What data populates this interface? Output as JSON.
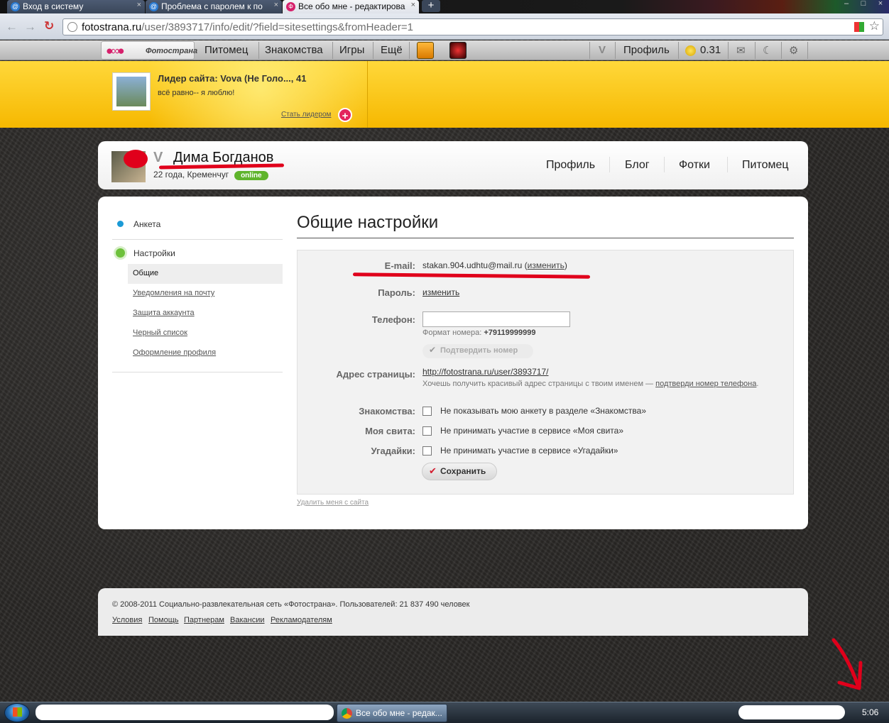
{
  "browser": {
    "tabs": [
      {
        "title": "Вход в систему",
        "favicon": "mail-icon",
        "active": false
      },
      {
        "title": "Проблема с паролем к по",
        "favicon": "mail-icon",
        "active": false
      },
      {
        "title": "Все обо мне - редактирова",
        "favicon": "fotostrana-icon",
        "active": true
      }
    ],
    "url_domain": "fotostrana.ru",
    "url_path": "/user/3893717/info/edit/?field=sitesettings&fromHeader=1"
  },
  "topmenu": {
    "logo_text": "Фотострана",
    "items": [
      "Питомец",
      "Знакомства",
      "Игры",
      "Ещё"
    ],
    "v_label": "V",
    "profile": "Профиль",
    "balance": "0.31"
  },
  "banner": {
    "leader_title": "Лидер сайта: Vova (Не Голо..., 41",
    "leader_text": "всё равно-- я люблю!",
    "become_leader": "Стать лидером",
    "plus": "+"
  },
  "profile": {
    "v_badge": "V",
    "name": "Дима Богданов",
    "meta": "22 года, Кременчуг",
    "status": "online",
    "nav": [
      "Профиль",
      "Блог",
      "Фотки",
      "Питомец"
    ]
  },
  "sidebar": {
    "anketa": "Анкета",
    "settings": "Настройки",
    "sub": [
      "Общие",
      "Уведомления на почту",
      "Защита аккаунта",
      "Черный список",
      "Оформление профиля"
    ]
  },
  "settings": {
    "title": "Общие настройки",
    "email_label": "E-mail:",
    "email_value": "stakan.904.udhtu@mail.ru",
    "email_change": "изменить",
    "password_label": "Пароль:",
    "password_change": "изменить",
    "phone_label": "Телефон:",
    "phone_value": "",
    "phone_format_label": "Формат номера:",
    "phone_format_value": "+79119999999",
    "confirm_button": "Подтвердить номер",
    "address_label": "Адрес страницы:",
    "address_value": "http://fotostrana.ru/user/3893717/",
    "address_hint": "Хочешь получить красивый адрес страницы с твоим именем —",
    "address_hint_link": "подтверди номер телефона",
    "address_hint_end": ".",
    "options": [
      {
        "label": "Знакомства:",
        "text": "Не показывать мою анкету в разделе «Знакомства»",
        "checked": false
      },
      {
        "label": "Моя свита:",
        "text": "Не принимать участие в сервисе «Моя свита»",
        "checked": false
      },
      {
        "label": "Угадайки:",
        "text": "Не принимать участие в сервисе «Угадайки»",
        "checked": false
      }
    ],
    "save_button": "Сохранить",
    "delete_link": "Удалить меня с сайта"
  },
  "footer": {
    "copyright": "©  2008-2011 Социально-развлекательная сеть «Фотострана». Пользователей: 21 837 490 человек",
    "links": [
      "Условия",
      "Помощь",
      "Партнерам",
      "Вакансии",
      "Рекламодателям"
    ]
  },
  "taskbar": {
    "task_title": "Все обо мне - редак...",
    "clock": "5:06"
  },
  "colors": {
    "accent_red": "#e0001b",
    "online_green": "#5fb42c",
    "banner_yellow": "#ffd83a"
  }
}
